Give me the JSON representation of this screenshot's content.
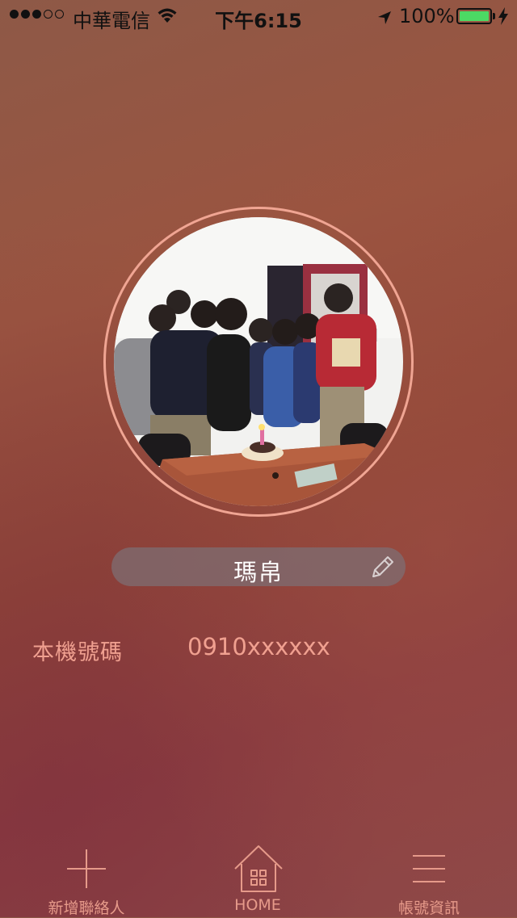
{
  "status_bar": {
    "signal_full_dots": 3,
    "signal_empty_dots": 2,
    "carrier": "中華電信",
    "time": "下午6:15",
    "battery_percent": "100%",
    "battery_color": "#4cd964"
  },
  "profile": {
    "photo": "group-birthday-photo",
    "name": "瑪帛"
  },
  "phone": {
    "label": "本機號碼",
    "number": "0910xxxxxx"
  },
  "tab_bar": {
    "items": [
      {
        "label": "新增聯絡人",
        "icon": "plus-icon"
      },
      {
        "label": "HOME",
        "icon": "house-icon"
      },
      {
        "label": "帳號資訊",
        "icon": "menu-icon"
      }
    ]
  },
  "colors": {
    "accent": "#f0a090",
    "ring": "#f0a593",
    "pill": "#7d6e73"
  }
}
